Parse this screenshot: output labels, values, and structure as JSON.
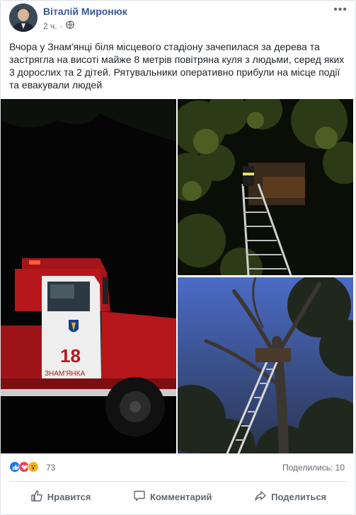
{
  "post": {
    "author": "Віталій Миронюк",
    "time": "2 ч.",
    "text": "Вчора у Знам'янці біля місцевого стадіону зачепилася за дерева та застрягла на висоті майже 8 метрів повітряна куля з людьми, серед яких 3 дорослих та 2 дітей. Рятувальники оперативно прибули на місце події та евакували людей"
  },
  "photos": {
    "truck_number": "18",
    "truck_text": "ЗНАМ'ЯНКА"
  },
  "reactions": {
    "icons": [
      "like-icon",
      "love-icon",
      "wow-icon"
    ],
    "count": "73",
    "shares": "Поделились: 10"
  },
  "actions": {
    "like": "Нравится",
    "comment": "Комментарий",
    "share": "Поделиться"
  },
  "colors": {
    "link": "#365899",
    "like": "#1877f2",
    "love": "#f33e58",
    "wow": "#f7b125",
    "truck_red": "#b5171b"
  }
}
